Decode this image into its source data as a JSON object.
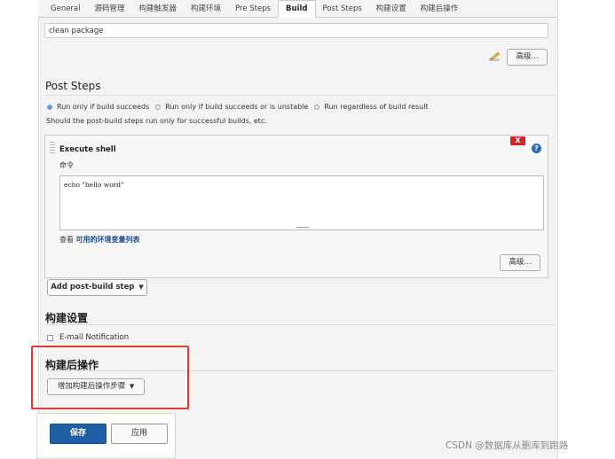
{
  "tabs": [
    {
      "label": "General",
      "active": false
    },
    {
      "label": "源码管理",
      "active": false
    },
    {
      "label": "构建触发器",
      "active": false
    },
    {
      "label": "构建环境",
      "active": false
    },
    {
      "label": "Pre Steps",
      "active": false
    },
    {
      "label": "Build",
      "active": true
    },
    {
      "label": "Post Steps",
      "active": false
    },
    {
      "label": "构建设置",
      "active": false
    },
    {
      "label": "构建后操作",
      "active": false
    }
  ],
  "build": {
    "goals_value": "clean package",
    "advanced_label": "高级..."
  },
  "post_steps": {
    "title": "Post Steps",
    "radio_options": [
      {
        "label": "Run only if build succeeds",
        "checked": true
      },
      {
        "label": "Run only if build succeeds or is unstable",
        "checked": false
      },
      {
        "label": "Run regardless of build result",
        "checked": false
      }
    ],
    "hint": "Should the post-build steps run only for successful builds, etc.",
    "shell": {
      "title": "Execute shell",
      "command_label": "命令",
      "command_value": "echo \"hello word\"",
      "env_prefix": "查看",
      "env_link": "可用的环境变量列表",
      "delete_label": "X",
      "help_label": "?",
      "advanced_label": "高级..."
    },
    "add_step_label": "Add post-build step"
  },
  "build_settings": {
    "title": "构建设置",
    "email_label": "E-mail Notification",
    "email_checked": false
  },
  "post_build": {
    "title": "构建后操作",
    "add_label": "增加构建后操作步骤"
  },
  "actions": {
    "save_label": "保存",
    "apply_label": "应用"
  },
  "watermark": "CSDN @数据库从删库到跑路",
  "colors": {
    "primary_button": "#1f5fa3",
    "highlight_box": "#e53935",
    "delete_button": "#d7222a",
    "link": "#204a87"
  }
}
